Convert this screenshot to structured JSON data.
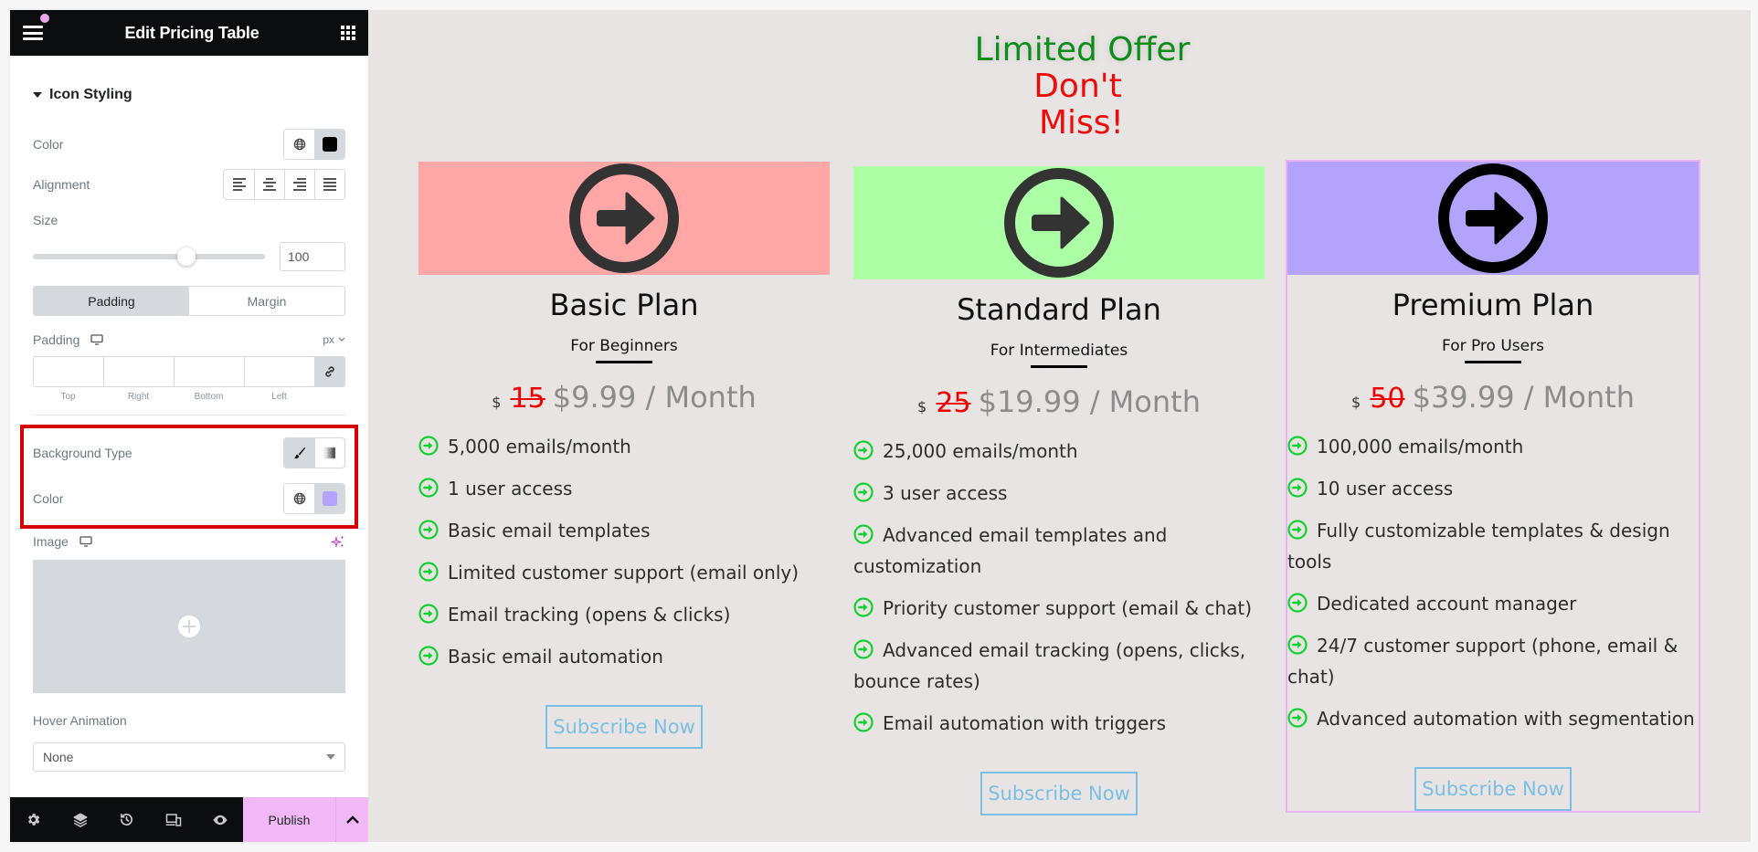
{
  "panel": {
    "title": "Edit Pricing Table",
    "section_title": "Icon Styling",
    "icon_color": {
      "label": "Color",
      "value": "#000000"
    },
    "alignment": {
      "label": "Alignment",
      "options": [
        "left",
        "center",
        "right",
        "justify"
      ]
    },
    "size": {
      "label": "Size",
      "value": "100",
      "slider_fraction": 0.66
    },
    "spacing_tabs": {
      "options": [
        "Padding",
        "Margin"
      ],
      "active": "Padding"
    },
    "padding": {
      "label": "Padding",
      "unit": "px",
      "fields": [
        {
          "label": "Top",
          "value": ""
        },
        {
          "label": "Right",
          "value": ""
        },
        {
          "label": "Bottom",
          "value": ""
        },
        {
          "label": "Left",
          "value": ""
        }
      ]
    },
    "background_type": {
      "label": "Background Type",
      "options": [
        "classic",
        "gradient"
      ],
      "active": "classic"
    },
    "background_color": {
      "label": "Color",
      "value": "#b3a3fb"
    },
    "image": {
      "label": "Image"
    },
    "hover_animation": {
      "label": "Hover Animation",
      "value": "None"
    },
    "footer": {
      "icons": [
        "settings-icon",
        "layers-icon",
        "history-icon",
        "responsive-icon",
        "preview-eye-icon"
      ],
      "publish_label": "Publish"
    }
  },
  "banner": {
    "line1": "Limited Offer",
    "line2": "Don't",
    "line3": "Miss!"
  },
  "colors": {
    "banner_green": "#0f8d1a",
    "banner_red": "#ee0b0b",
    "check_green": "#12d12e",
    "subscribe_blue": "#7bbfe3",
    "old_price_red": "#f00000",
    "selection_outline": "#eab3f2"
  },
  "plans": [
    {
      "name": "Basic Plan",
      "subtitle": "For Beginners",
      "currency": "$",
      "old_price": "15",
      "price": "$9.99 / Month",
      "header_color": "#ffa6a6",
      "icon_color": "#333333",
      "features": [
        "5,000 emails/month",
        "1 user access",
        "Basic email templates",
        "Limited customer support (email only)",
        "Email tracking (opens & clicks)",
        "Basic email automation"
      ],
      "button": "Subscribe Now"
    },
    {
      "name": "Standard Plan",
      "subtitle": "For Intermediates",
      "currency": "$",
      "old_price": "25",
      "price": "$19.99 / Month",
      "header_color": "#adffa6",
      "icon_color": "#333333",
      "features": [
        "25,000 emails/month",
        "3 user access",
        "Advanced email templates and customization",
        "Priority customer support (email & chat)",
        "Advanced email tracking (opens, clicks, bounce rates)",
        "Email automation with triggers"
      ],
      "button": "Subscribe Now"
    },
    {
      "name": "Premium Plan",
      "subtitle": "For Pro Users",
      "currency": "$",
      "old_price": "50",
      "price": "$39.99 / Month",
      "header_color": "#b3a3fb",
      "icon_color": "#000000",
      "features": [
        "100,000 emails/month",
        "10 user access",
        "Fully customizable templates & design tools",
        "Dedicated account manager",
        "24/7 customer support (phone, email & chat)",
        "Advanced automation with segmentation"
      ],
      "button": "Subscribe Now",
      "selected": true
    }
  ]
}
